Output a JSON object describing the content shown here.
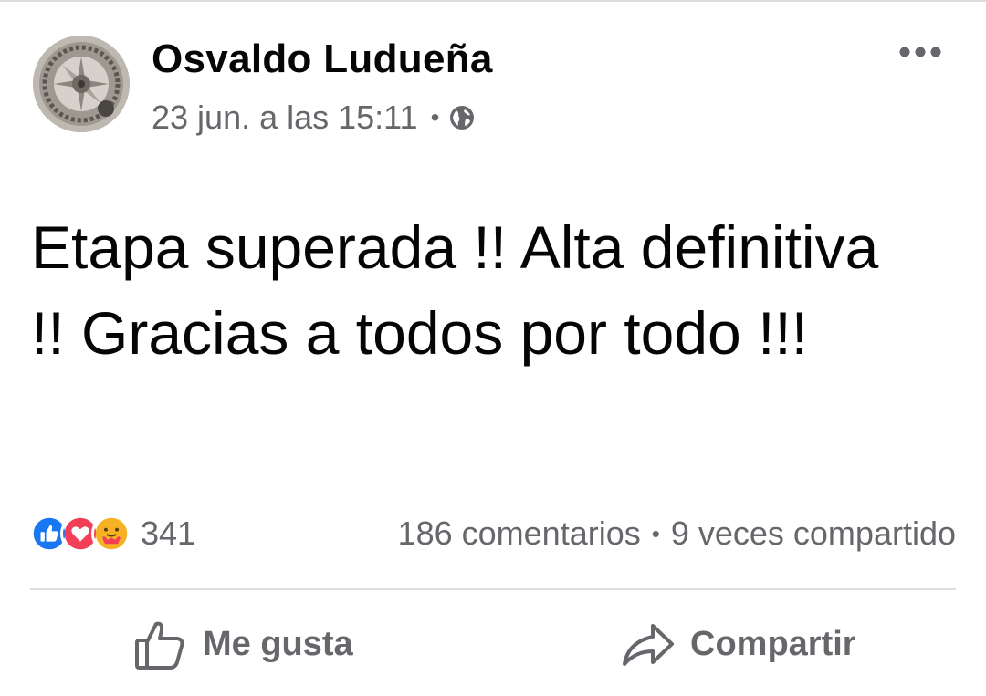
{
  "post": {
    "author": "Osvaldo Ludueña",
    "timestamp": "23 jun. a las 15:11",
    "meta_separator": "•",
    "privacy_icon": "globe-icon",
    "more_icon": "more-horizontal-icon",
    "text": "Etapa superada !! Alta definitiva !! Gracias a todos por todo !!!"
  },
  "stats": {
    "reaction_icons": [
      "like-reaction-icon",
      "love-reaction-icon",
      "care-reaction-icon"
    ],
    "reaction_count": "341",
    "comments": "186 comentarios",
    "separator": "•",
    "shares": "9 veces compartido"
  },
  "actions": {
    "like_label": "Me gusta",
    "like_icon": "thumbs-up-icon",
    "share_label": "Compartir",
    "share_icon": "share-arrow-icon"
  },
  "colors": {
    "text_primary": "#050505",
    "text_secondary": "#65676b",
    "like_blue": "#1877f2",
    "love_red": "#f33e58",
    "care_yellow": "#f7b125",
    "divider": "#dadde1"
  }
}
